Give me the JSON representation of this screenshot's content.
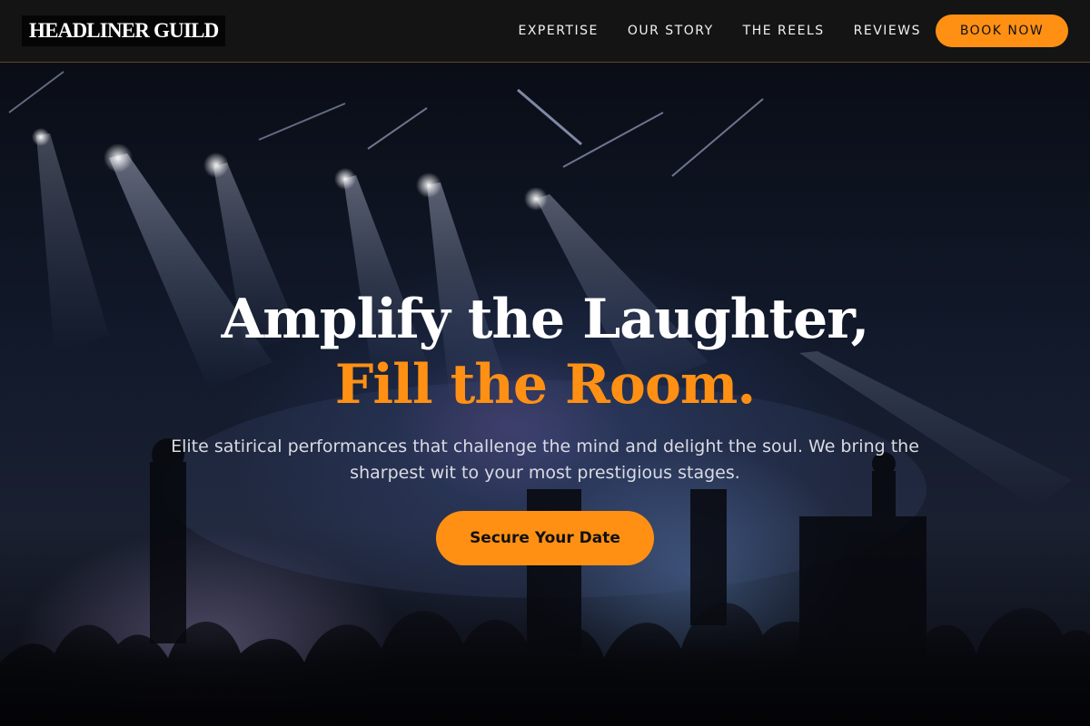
{
  "brand": {
    "logo_text": "HEADLINER GUILD"
  },
  "nav": {
    "items": [
      "EXPERTISE",
      "OUR STORY",
      "THE REELS",
      "REVIEWS"
    ],
    "cta_label": "BOOK NOW"
  },
  "hero": {
    "headline_line1": "Amplify the Laughter,",
    "headline_line2": "Fill the Room.",
    "subtext": "Elite satirical performances that challenge the mind and delight the soul. We bring the sharpest wit to your most prestigious stages.",
    "cta_label": "Secure Your Date",
    "background_image": "concert-stage-crowd"
  },
  "colors": {
    "accent": "#ff9014",
    "header_bg": "#141414",
    "text": "#ffffff"
  }
}
